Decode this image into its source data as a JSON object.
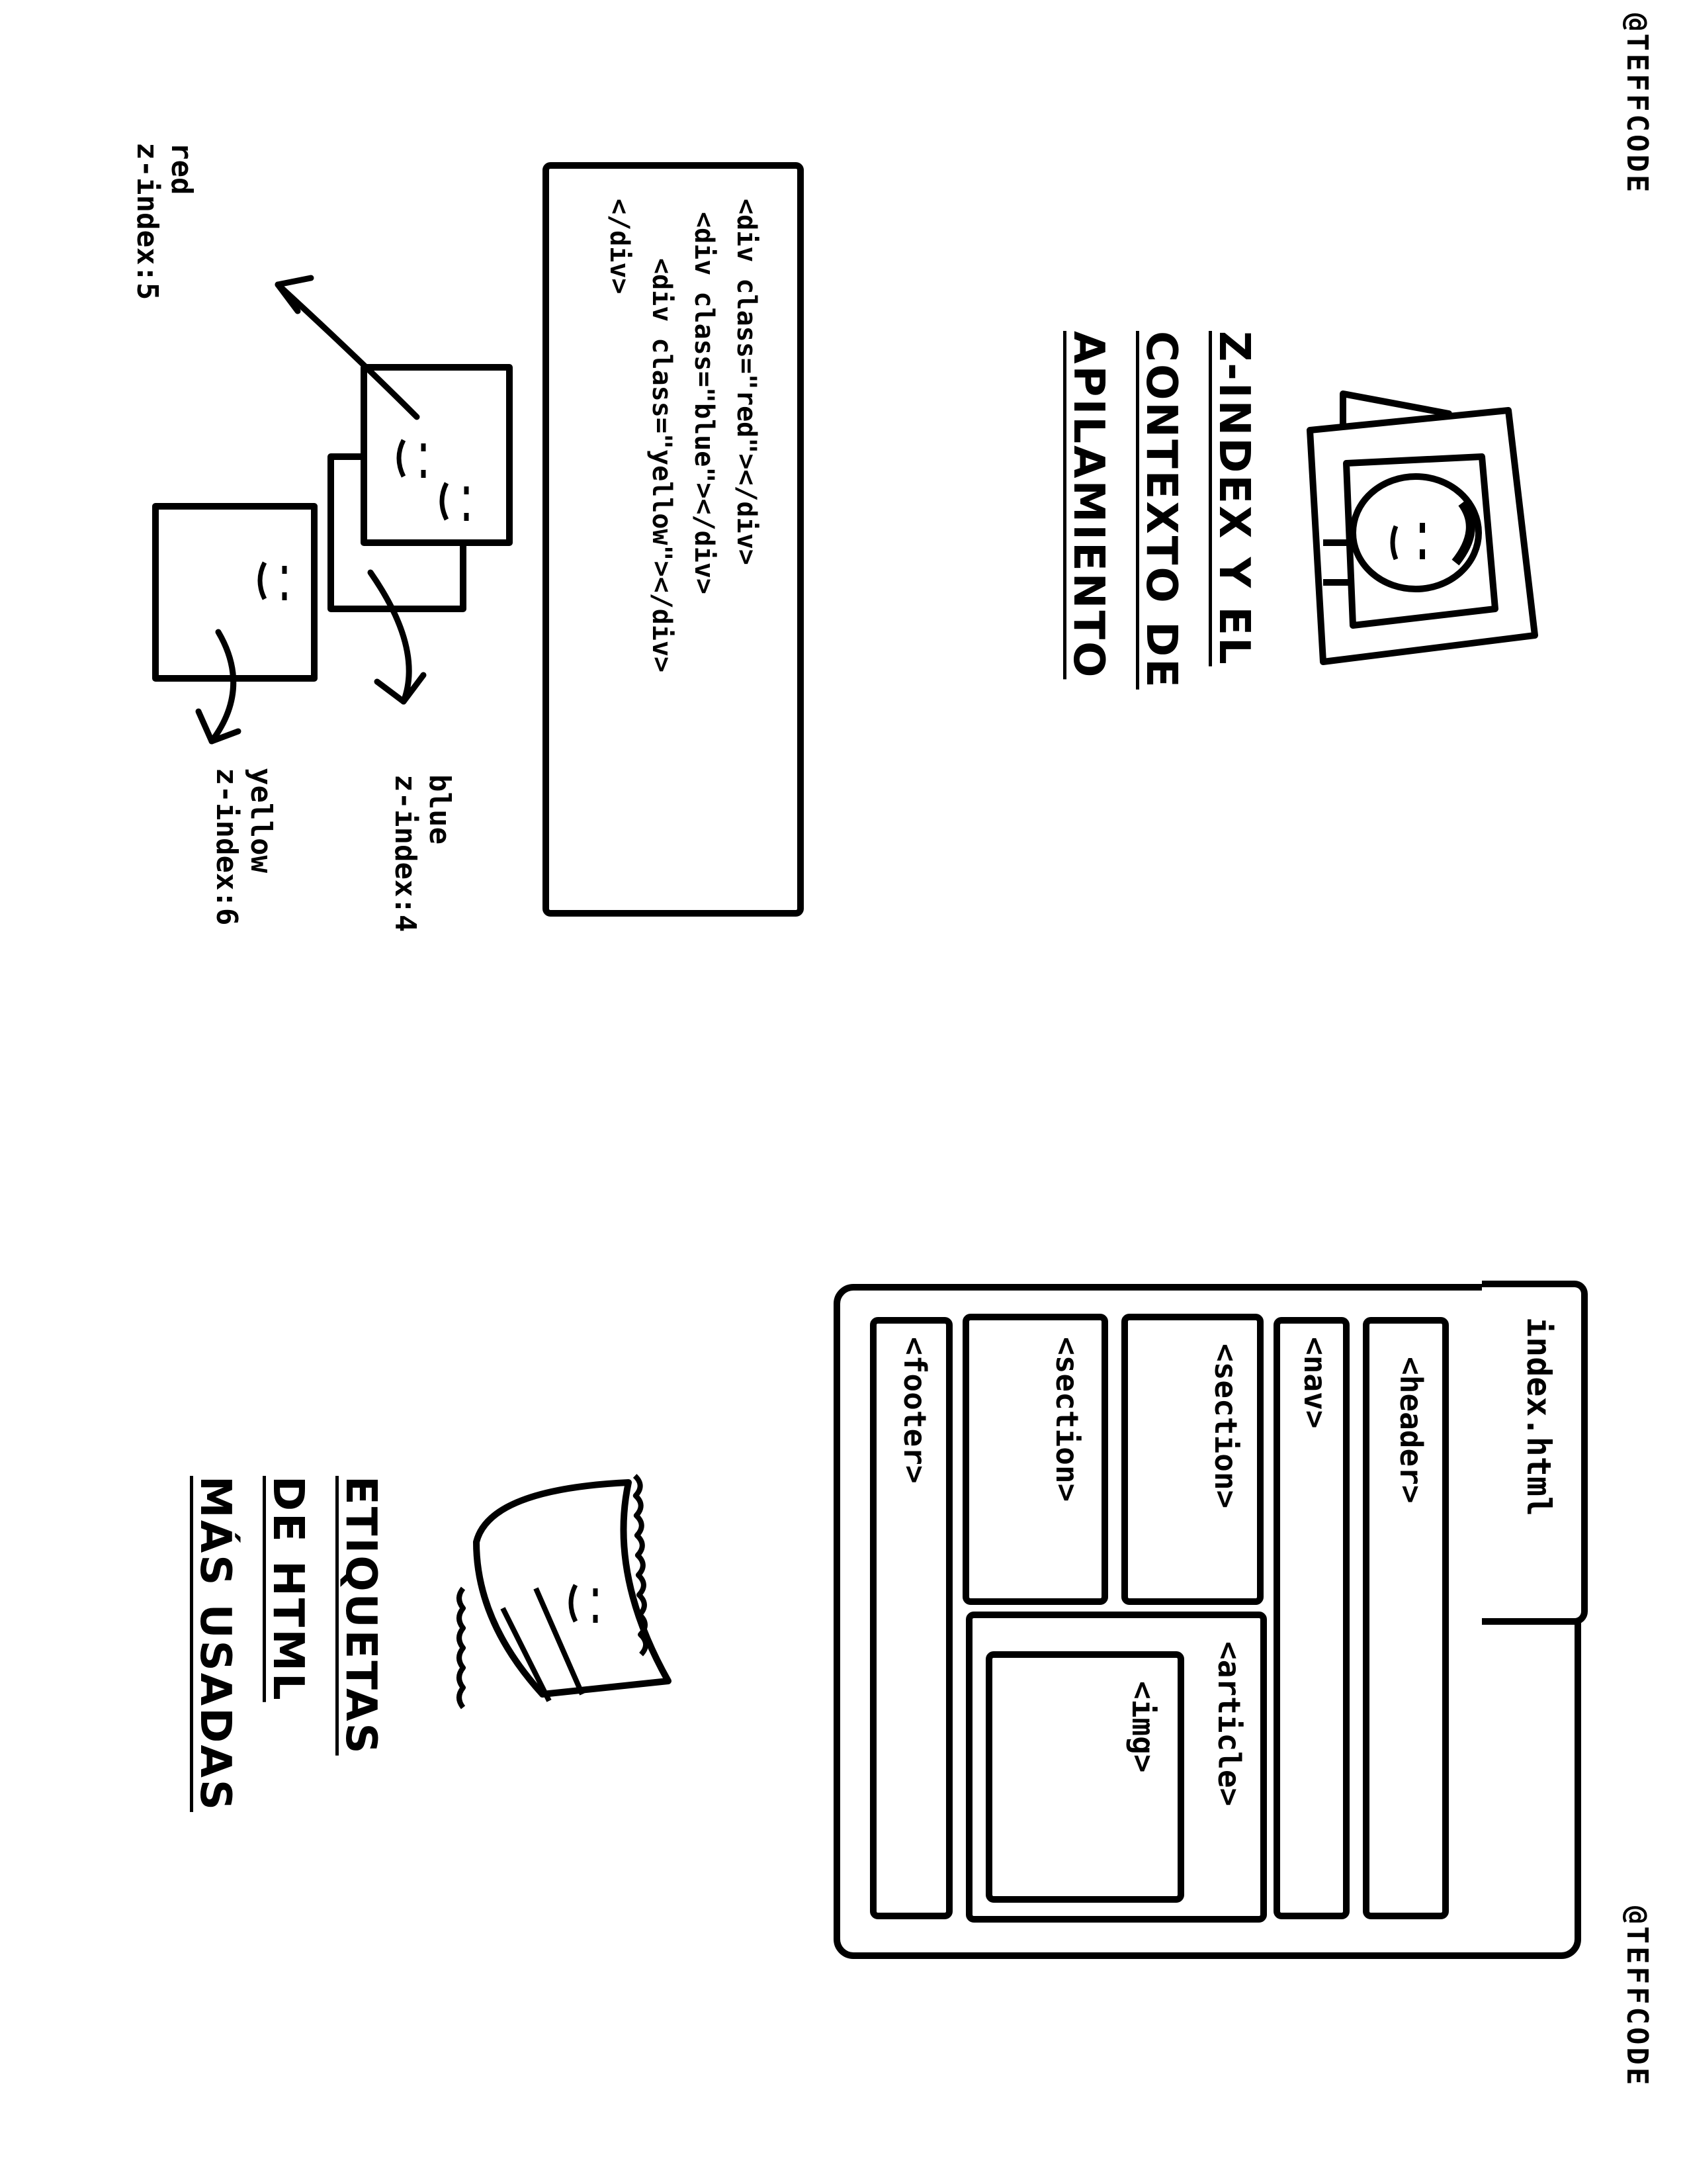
{
  "credits": [
    "@TEFFCODE",
    "@TEFFCODE"
  ],
  "zindex_section": {
    "title_lines": [
      "Z-INDEX Y EL",
      "CONTEXTO DE",
      "APILAMIENTO"
    ],
    "code_lines": [
      "<div class=\"red\"></div>",
      "<div class=\"blue\"></div>",
      "<div class=\"yellow\"></div>",
      "</div>"
    ],
    "labels": {
      "red": [
        "red",
        "z-index:5"
      ],
      "blue": [
        "blue",
        "z-index:4"
      ],
      "yellow": [
        "yellow",
        "z-index:6"
      ]
    }
  },
  "html_section": {
    "title_lines": [
      "ETIQUETAS",
      "DE HTML",
      "MÁS USADAS"
    ],
    "file_name": "index.html",
    "tags": {
      "header": "<header>",
      "nav": "<nav>",
      "section1": "<section>",
      "article": "<article>",
      "img": "<img>",
      "section2": "<section>",
      "footer": "<footer>"
    }
  }
}
